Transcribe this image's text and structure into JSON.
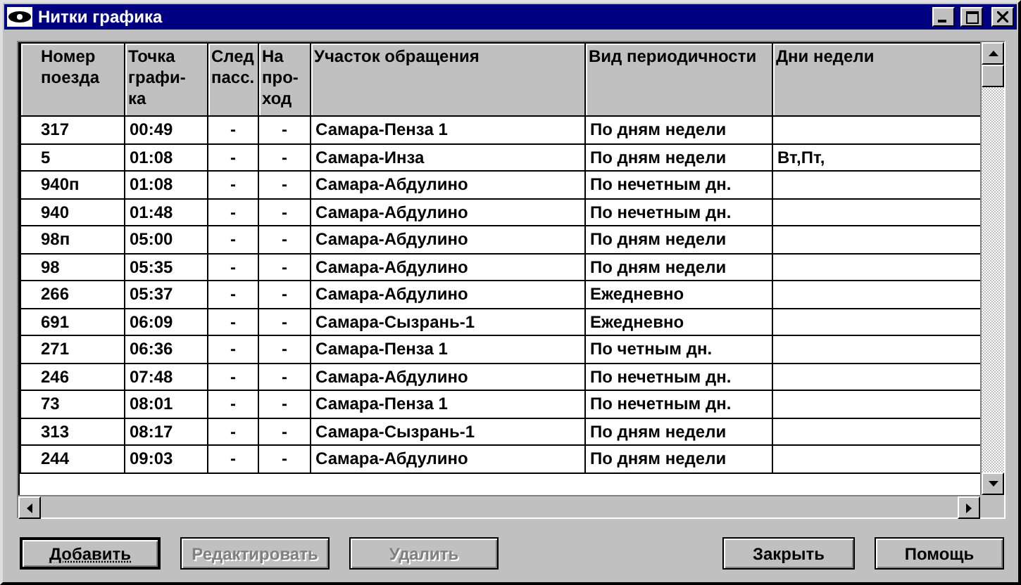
{
  "window": {
    "title": "Нитки графика"
  },
  "table": {
    "columns": [
      "Номер\nпоезда",
      "Точка\nграфи-\nка",
      "След\nпасс.",
      "На\nпро-\nход",
      "Участок обращения",
      "Вид периодичности",
      "Дни недели"
    ],
    "rows": [
      [
        "317",
        "00:49",
        "-",
        "-",
        "Самара-Пенза 1",
        "По дням недели",
        ""
      ],
      [
        "5",
        "01:08",
        "-",
        "-",
        "Самара-Инза",
        "По дням недели",
        "Вт,Пт,"
      ],
      [
        "940п",
        "01:08",
        "-",
        "-",
        "Самара-Абдулино",
        "По нечетным дн.",
        ""
      ],
      [
        "940",
        "01:48",
        "-",
        "-",
        "Самара-Абдулино",
        "По нечетным дн.",
        ""
      ],
      [
        "98п",
        "05:00",
        "-",
        "-",
        "Самара-Абдулино",
        "По дням недели",
        ""
      ],
      [
        "98",
        "05:35",
        "-",
        "-",
        "Самара-Абдулино",
        "По дням недели",
        ""
      ],
      [
        "266",
        "05:37",
        "-",
        "-",
        "Самара-Абдулино",
        "Ежедневно",
        ""
      ],
      [
        "691",
        "06:09",
        "-",
        "-",
        "Самара-Сызрань-1",
        "Ежедневно",
        ""
      ],
      [
        "271",
        "06:36",
        "-",
        "-",
        "Самара-Пенза 1",
        "По четным дн.",
        ""
      ],
      [
        "246",
        "07:48",
        "-",
        "-",
        "Самара-Абдулино",
        "По нечетным дн.",
        ""
      ],
      [
        "73",
        "08:01",
        "-",
        "-",
        "Самара-Пенза 1",
        "По нечетным дн.",
        ""
      ],
      [
        "313",
        "08:17",
        "-",
        "-",
        "Самара-Сызрань-1",
        "По дням недели",
        ""
      ],
      [
        "244",
        "09:03",
        "-",
        "-",
        "Самара-Абдулино",
        "По дням недели",
        ""
      ]
    ]
  },
  "buttons": [
    {
      "label": "Добавить",
      "disabled": false,
      "default": true
    },
    {
      "label": "Редактировать",
      "disabled": true,
      "default": false
    },
    {
      "label": "Удалить",
      "disabled": true,
      "default": false
    },
    {
      "label": "Закрыть",
      "disabled": false,
      "default": false
    },
    {
      "label": "Помощь",
      "disabled": false,
      "default": false
    }
  ]
}
